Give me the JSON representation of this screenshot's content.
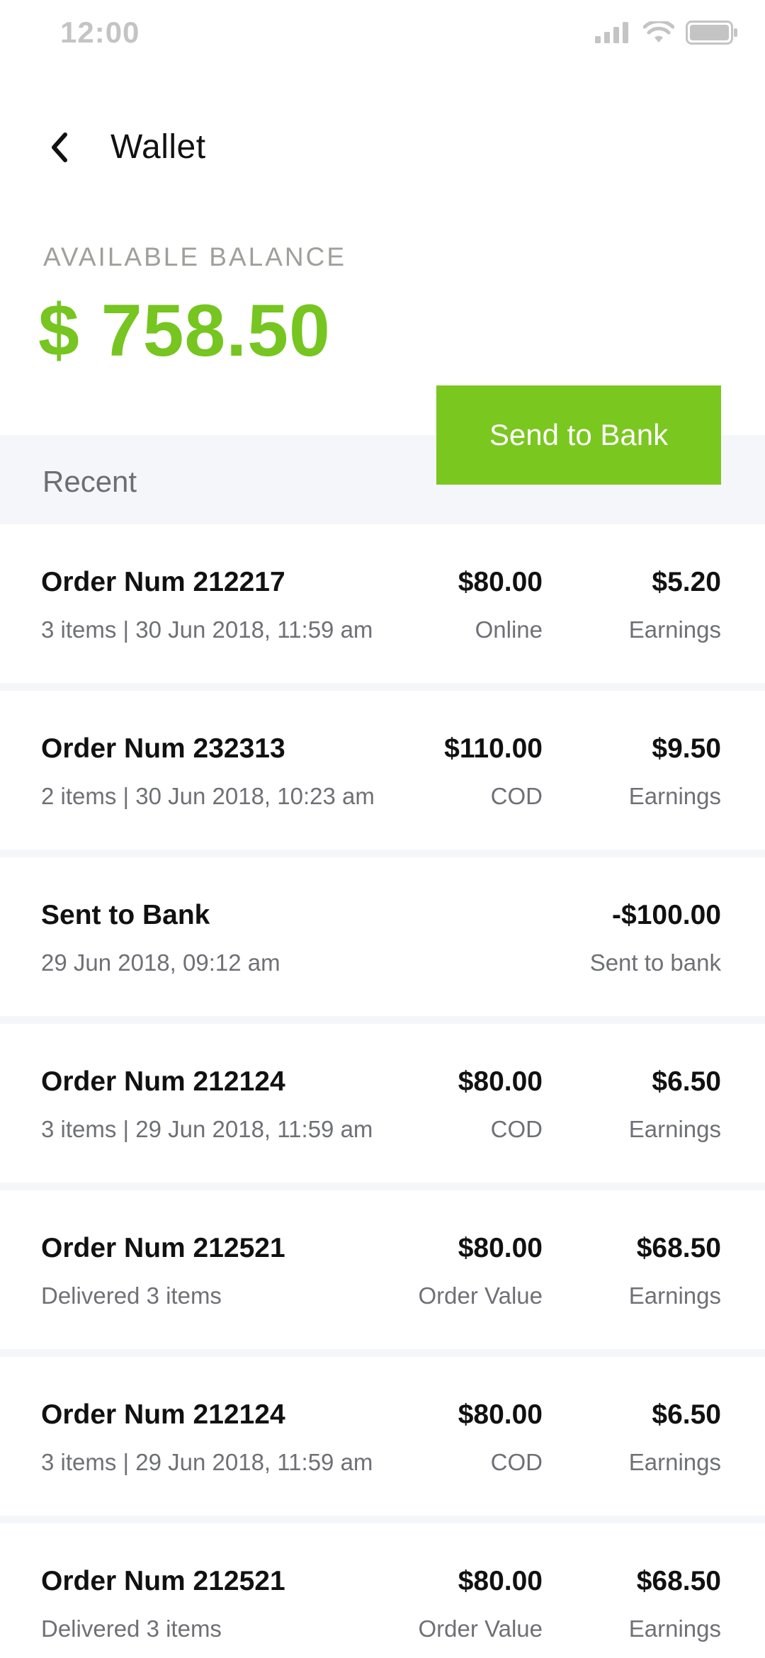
{
  "status_bar": {
    "time": "12:00",
    "icons": [
      "signal-icon",
      "wifi-icon",
      "battery-icon"
    ]
  },
  "header": {
    "title": "Wallet",
    "back_icon": "chevron-left-icon"
  },
  "balance": {
    "label": "AVAILABLE BALANCE",
    "amount": "$ 758.50"
  },
  "actions": {
    "send_to_bank_label": "Send to Bank"
  },
  "recent": {
    "label": "Recent"
  },
  "colors": {
    "accent_green": "#7ac720",
    "balance_green": "#76c520",
    "band_bg": "#f5f6fa",
    "muted_text": "#6f7075",
    "label_gray": "#9ea09a"
  },
  "transactions": [
    {
      "title": "Order Num 212217",
      "subtitle": "3 items | 30 Jun 2018, 11:59 am",
      "amount": "$80.00",
      "amount_label": "Online",
      "earning": "$5.20",
      "earning_label": "Earnings"
    },
    {
      "title": "Order Num 232313",
      "subtitle": "2 items | 30 Jun 2018, 10:23 am",
      "amount": "$110.00",
      "amount_label": "COD",
      "earning": "$9.50",
      "earning_label": "Earnings"
    },
    {
      "title": "Sent to Bank",
      "subtitle": "29 Jun 2018, 09:12 am",
      "amount": "",
      "amount_label": "",
      "earning": "-$100.00",
      "earning_label": "Sent to bank"
    },
    {
      "title": "Order Num 212124",
      "subtitle": "3 items | 29 Jun 2018, 11:59 am",
      "amount": "$80.00",
      "amount_label": "COD",
      "earning": "$6.50",
      "earning_label": "Earnings"
    },
    {
      "title": "Order Num 212521",
      "subtitle": "Delivered 3 items",
      "amount": "$80.00",
      "amount_label": "Order Value",
      "earning": "$68.50",
      "earning_label": "Earnings"
    },
    {
      "title": "Order Num 212124",
      "subtitle": "3 items | 29 Jun 2018, 11:59 am",
      "amount": "$80.00",
      "amount_label": "COD",
      "earning": "$6.50",
      "earning_label": "Earnings"
    },
    {
      "title": "Order Num 212521",
      "subtitle": "Delivered 3 items",
      "amount": "$80.00",
      "amount_label": "Order Value",
      "earning": "$68.50",
      "earning_label": "Earnings"
    }
  ]
}
